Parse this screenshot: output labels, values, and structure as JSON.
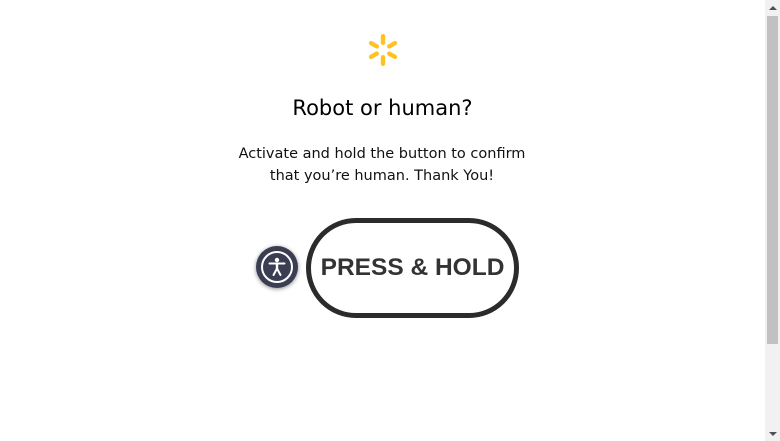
{
  "header": {
    "logo_icon": "walmart-spark-icon",
    "logo_color": "#ffc220"
  },
  "main": {
    "title": "Robot or human?",
    "description_line1": "Activate and hold the button to confirm",
    "description_line2": "that you’re human. Thank You!",
    "accessibility_icon": "accessibility-person-icon",
    "press_hold_label": "PRESS & HOLD"
  },
  "scrollbar": {
    "up_icon": "scroll-up-arrow-icon",
    "down_icon": "scroll-down-arrow-icon"
  }
}
